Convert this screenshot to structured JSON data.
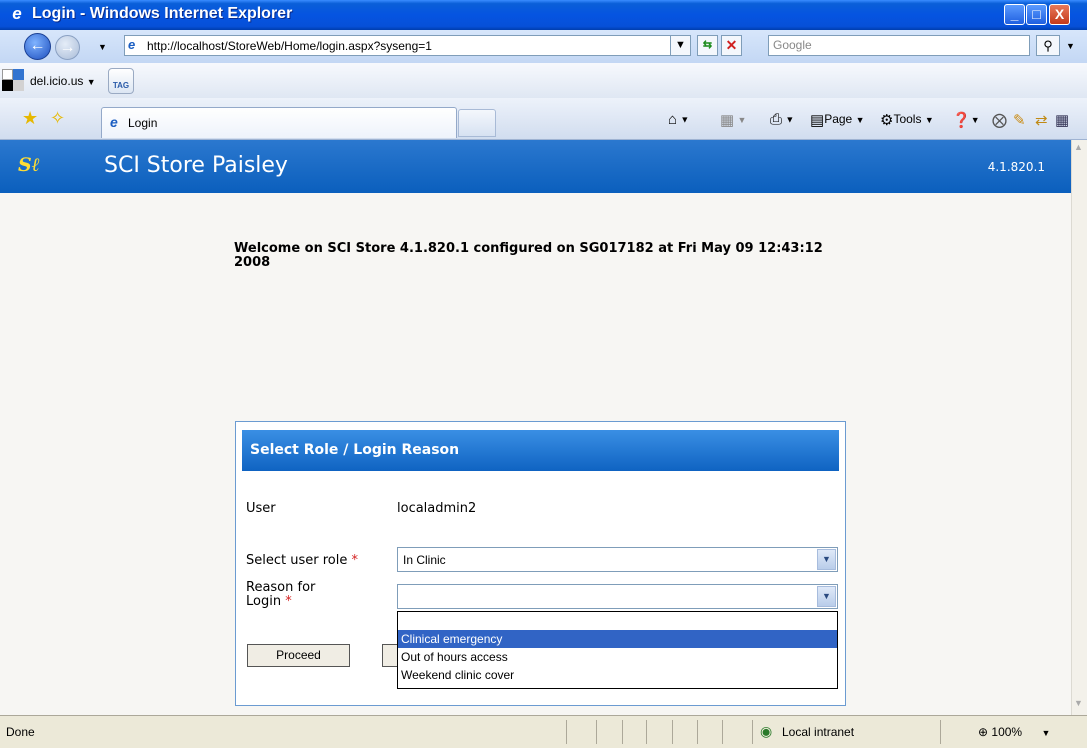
{
  "window": {
    "title": "Login - Windows Internet Explorer",
    "min": "_",
    "max": "□",
    "close": "X"
  },
  "address": {
    "url": "http://localhost/StoreWeb/Home/login.aspx?syseng=1",
    "search_placeholder": "Google"
  },
  "links": {
    "delicious": "del.icio.us",
    "tag": "TAG"
  },
  "tabs": {
    "active": "Login"
  },
  "commands": {
    "page": "Page",
    "tools": "Tools"
  },
  "app": {
    "name": "SCI Store Paisley",
    "version": "4.1.820.1",
    "welcome": "Welcome on SCI Store 4.1.820.1 configured on SG017182 at Fri May 09 12:43:12 2008"
  },
  "panel": {
    "title": "Select Role / Login Reason",
    "user_label": "User",
    "user_value": "localadmin2",
    "role_label": "Select user role",
    "role_value": "In Clinic",
    "reason_label_1": "Reason for",
    "reason_label_2": "Login",
    "required": "*",
    "reason_value": "",
    "options": [
      "",
      "Clinical emergency",
      "Out of hours access",
      "Weekend clinic cover"
    ],
    "proceed": "Proceed"
  },
  "status": {
    "left": "Done",
    "zone": "Local intranet",
    "zoom": "100%"
  }
}
